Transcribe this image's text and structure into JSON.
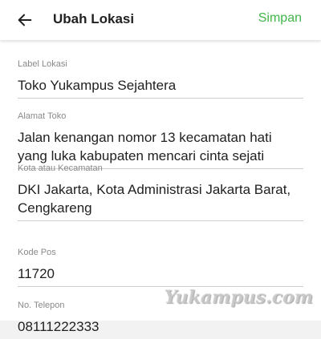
{
  "header": {
    "title": "Ubah Lokasi",
    "save_label": "Simpan",
    "back_icon": "arrow-left-icon"
  },
  "form": {
    "label_lokasi": {
      "label": "Label Lokasi",
      "value": "Toko Yukampus Sejahtera"
    },
    "alamat_toko": {
      "label": "Alamat Toko",
      "value": "Jalan kenangan nomor 13 kecamatan hati yang luka kabupaten mencari cinta sejati"
    },
    "kota_kecamatan": {
      "label": "Kota atau Kecamatan",
      "value": "DKI Jakarta, Kota Administrasi Jakarta Barat, Cengkareng"
    },
    "kode_pos": {
      "label": "Kode Pos",
      "value": "11720"
    },
    "no_telepon": {
      "label": "No. Telepon",
      "value": "08111222333"
    }
  },
  "watermark": "Yukampus.com",
  "colors": {
    "accent": "#42b549",
    "text": "#212121",
    "label": "#8a8a8a",
    "divider": "#cfcfcf"
  }
}
